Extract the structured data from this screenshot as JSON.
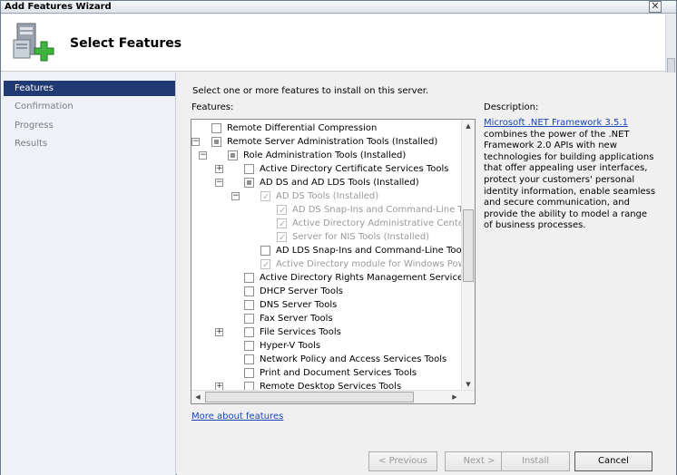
{
  "window": {
    "title": "Add Features Wizard",
    "close_glyph": "✕"
  },
  "header": {
    "title": "Select Features",
    "icon": "features-wizard-icon"
  },
  "nav": {
    "items": [
      {
        "label": "Features",
        "active": true
      },
      {
        "label": "Confirmation",
        "active": false
      },
      {
        "label": "Progress",
        "active": false
      },
      {
        "label": "Results",
        "active": false
      }
    ]
  },
  "main": {
    "intro": "Select one or more features to install on this server.",
    "features_label": "Features:",
    "description_label": "Description:",
    "description_link": "Microsoft .NET Framework 3.5.1",
    "description_text": "combines the power of the .NET Framework 2.0 APIs with new technologies for building applications that offer appealing user interfaces, protect your customers' personal identity information, enable seamless and secure communication, and provide the ability to model a range of business processes.",
    "more_link": "More about features"
  },
  "tree": [
    {
      "label": "Remote Differential Compression",
      "state": "unchecked",
      "expander": null,
      "disabled": false,
      "level": 1
    },
    {
      "label": "Remote Server Administration Tools  (Installed)",
      "state": "indeterminate",
      "expander": "−",
      "disabled": false,
      "level": 1
    },
    {
      "label": "Role Administration Tools  (Installed)",
      "state": "indeterminate",
      "expander": "−",
      "disabled": false,
      "level": 2
    },
    {
      "label": "Active Directory Certificate Services Tools",
      "state": "unchecked",
      "expander": "+",
      "disabled": false,
      "level": 3
    },
    {
      "label": "AD DS and AD LDS Tools  (Installed)",
      "state": "indeterminate",
      "expander": "−",
      "disabled": false,
      "level": 3
    },
    {
      "label": "AD DS Tools  (Installed)",
      "state": "checked",
      "expander": "−",
      "disabled": true,
      "level": 4
    },
    {
      "label": "AD DS Snap-Ins and Command-Line Tools",
      "state": "checked",
      "expander": null,
      "disabled": true,
      "level": 5
    },
    {
      "label": "Active Directory Administrative Center  (I",
      "state": "checked",
      "expander": null,
      "disabled": true,
      "level": 5
    },
    {
      "label": "Server for NIS Tools  (Installed)",
      "state": "checked",
      "expander": null,
      "disabled": true,
      "level": 5
    },
    {
      "label": "AD LDS Snap-Ins and Command-Line Tools",
      "state": "unchecked",
      "expander": null,
      "disabled": false,
      "level": 4
    },
    {
      "label": "Active Directory module for Windows PowerSh",
      "state": "checked",
      "expander": null,
      "disabled": true,
      "level": 4
    },
    {
      "label": "Active Directory Rights Management Services Too",
      "state": "unchecked",
      "expander": null,
      "disabled": false,
      "level": 3
    },
    {
      "label": "DHCP Server Tools",
      "state": "unchecked",
      "expander": null,
      "disabled": false,
      "level": 3
    },
    {
      "label": "DNS Server Tools",
      "state": "unchecked",
      "expander": null,
      "disabled": false,
      "level": 3
    },
    {
      "label": "Fax Server Tools",
      "state": "unchecked",
      "expander": null,
      "disabled": false,
      "level": 3
    },
    {
      "label": "File Services Tools",
      "state": "unchecked",
      "expander": "+",
      "disabled": false,
      "level": 3
    },
    {
      "label": "Hyper-V Tools",
      "state": "unchecked",
      "expander": null,
      "disabled": false,
      "level": 3
    },
    {
      "label": "Network Policy and Access Services Tools",
      "state": "unchecked",
      "expander": null,
      "disabled": false,
      "level": 3
    },
    {
      "label": "Print and Document Services Tools",
      "state": "unchecked",
      "expander": null,
      "disabled": false,
      "level": 3
    },
    {
      "label": "Remote Desktop Services Tools",
      "state": "unchecked",
      "expander": "+",
      "disabled": false,
      "level": 3
    }
  ],
  "buttons": {
    "previous": "< Previous",
    "next": "Next >",
    "install": "Install",
    "cancel": "Cancel"
  },
  "colors": {
    "nav_active": "#223a73",
    "link": "#1a47b3"
  }
}
